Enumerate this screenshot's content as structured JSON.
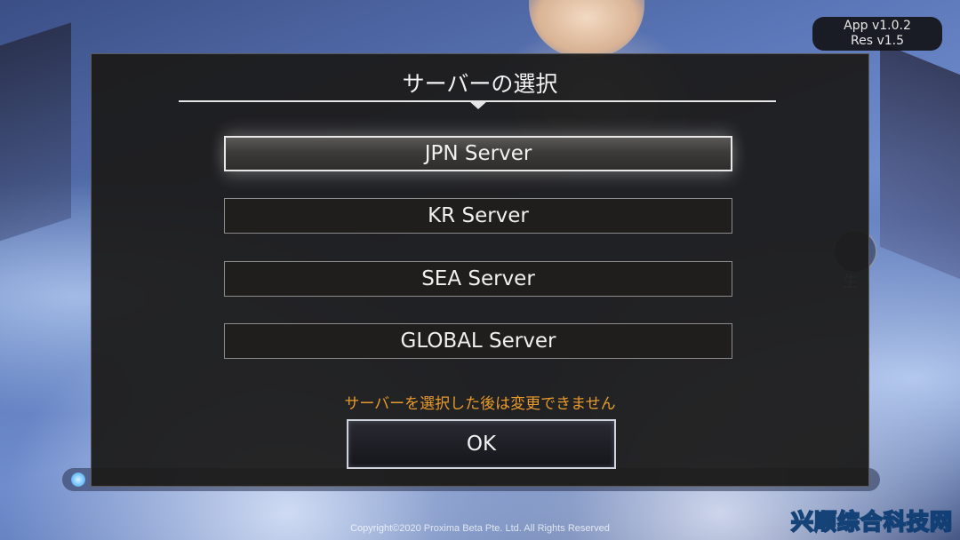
{
  "version": {
    "app": "App v1.0.2",
    "res": "Res v1.5"
  },
  "dialog": {
    "title": "サーバーの選択",
    "servers": [
      {
        "label": "JPN Server",
        "selected": true
      },
      {
        "label": "KR Server",
        "selected": false
      },
      {
        "label": "SEA Server",
        "selected": false
      },
      {
        "label": "GLOBAL Server",
        "selected": false
      }
    ],
    "warning": "サーバーを選択した後は変更できません",
    "ok_label": "OK"
  },
  "background": {
    "side_label": "生",
    "copyright": "Copyright©2020 Proxima Beta Pte. Ltd. All Rights Reserved"
  },
  "watermark": "兴顺综合科技网",
  "colors": {
    "dialog_bg": "#1c1b1a",
    "warning": "#e89a2c",
    "text": "#f0f0f0"
  }
}
